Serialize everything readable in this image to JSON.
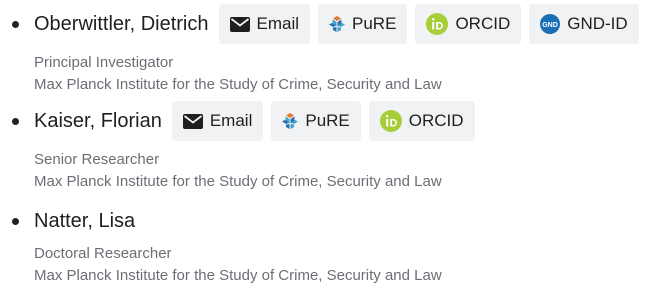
{
  "people": [
    {
      "name": "Oberwittler, Dietrich",
      "role": "Principal Investigator",
      "institution": "Max Planck Institute for the Study of Crime, Security and Law",
      "links": {
        "email": "Email",
        "pure": "PuRE",
        "orcid": "ORCID",
        "gnd": "GND-ID"
      }
    },
    {
      "name": "Kaiser, Florian",
      "role": "Senior Researcher",
      "institution": "Max Planck Institute for the Study of Crime, Security and Law",
      "links": {
        "email": "Email",
        "pure": "PuRE",
        "orcid": "ORCID"
      }
    },
    {
      "name": "Natter, Lisa",
      "role": "Doctoral Researcher",
      "institution": "Max Planck Institute for the Study of Crime, Security and Law"
    }
  ],
  "icons": {
    "email": "envelope-icon",
    "pure": "pure-logo-icon",
    "orcid": "orcid-icon",
    "gnd": "gnd-icon"
  },
  "colors": {
    "orcid_green": "#a6ce39",
    "gnd_blue": "#1a6fb5",
    "pure_blue": "#2c6db5",
    "pure_teal": "#3aa6c9",
    "pure_orange": "#e0792b",
    "text_muted": "#6b6f75",
    "badge_bg": "#f1f2f4"
  }
}
